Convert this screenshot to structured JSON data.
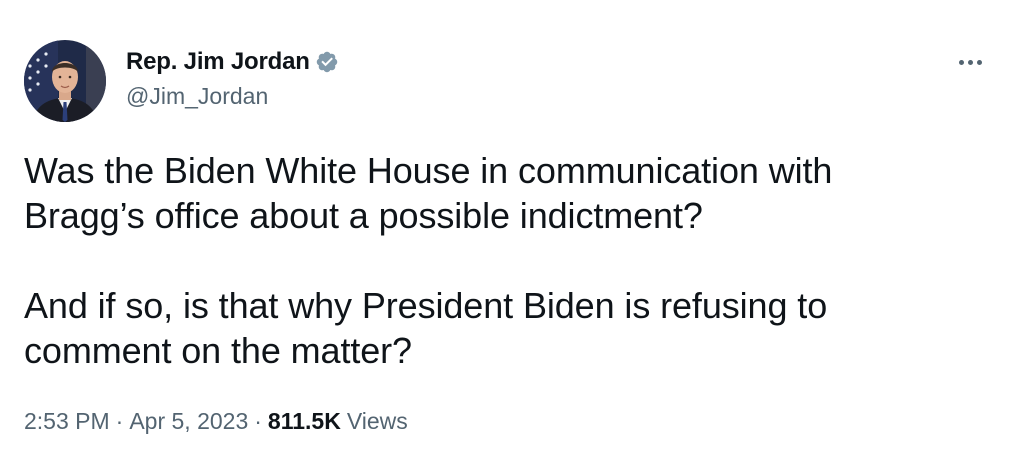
{
  "author": {
    "display_name": "Rep. Jim Jordan",
    "handle": "@Jim_Jordan",
    "verified": true,
    "verified_icon": "verified-badge-icon",
    "avatar": "profile-photo"
  },
  "menu": {
    "more_icon": "more-options-icon"
  },
  "tweet": {
    "paragraph_1_line_1": "Was the Biden White House in communication with",
    "paragraph_1_line_2": "Bragg’s office about a possible indictment?",
    "paragraph_2_line_1": "And if so, is that why President Biden is refusing to",
    "paragraph_2_line_2": "comment on the matter?"
  },
  "meta": {
    "time": "2:53 PM",
    "separator": "·",
    "date": "Apr 5, 2023",
    "views_count": "811.5K",
    "views_label": "Views"
  },
  "colors": {
    "text_primary": "#0f1419",
    "text_secondary": "#536471",
    "verified_blue": "#829aab",
    "background": "#ffffff"
  }
}
